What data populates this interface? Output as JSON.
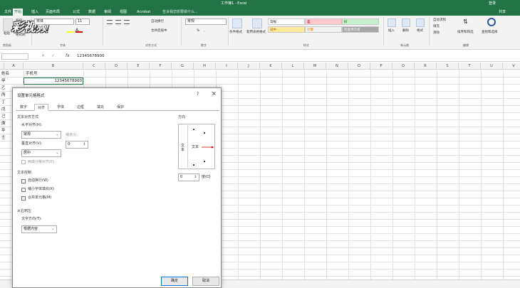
{
  "titlebar": {
    "title": "工作簿1 - Excel",
    "account": "登录",
    "share": "共享"
  },
  "tabs": [
    "文件",
    "开始",
    "插入",
    "页面布局",
    "公式",
    "数据",
    "审阅",
    "视图",
    "Acrobat"
  ],
  "active_tab": "开始",
  "tell_me": "告诉我您想要做什么...",
  "watermark": "彩视频",
  "ribbon": {
    "clipboard": {
      "paste_label": "粘贴",
      "cut": "剪切",
      "copy": "复制",
      "format_painter": "格式刷",
      "group": "剪贴板"
    },
    "font": {
      "name": "宋体",
      "size": "11",
      "bold": "B",
      "italic": "I",
      "underline": "U",
      "group": "字体"
    },
    "alignment": {
      "wrap": "自动换行",
      "merge": "合并后居中",
      "group": "对齐方式"
    },
    "number": {
      "format": "常规",
      "percent": "%",
      "comma": ",",
      "group": "数字"
    },
    "styles": {
      "cond_format": "条件格式",
      "table_format": "套用表格格式",
      "normal": "常规",
      "bad": "差",
      "good": "好",
      "neutral": "适中",
      "calc": "计算",
      "check": "检查单元格",
      "group": "样式"
    },
    "cells": {
      "insert": "插入",
      "delete": "删除",
      "format": "格式",
      "group": "单元格"
    },
    "editing": {
      "autosum": "自动求和",
      "fill": "填充",
      "clear": "清除",
      "sort": "排序和筛选",
      "find": "查找和选择",
      "group": "编辑"
    }
  },
  "formula_bar": {
    "name_box": "",
    "fx": "fx",
    "value": "12345678900"
  },
  "columns": [
    "A",
    "B",
    "C",
    "D",
    "E",
    "F",
    "G",
    "H",
    "I",
    "J",
    "K",
    "L",
    "M",
    "N",
    "O",
    "P",
    "Q",
    "R",
    "S",
    "T",
    "U",
    "V"
  ],
  "cells": {
    "a1": "姓名",
    "b1": "手机号",
    "b2": "12345678900",
    "a_col": [
      "甲",
      "乙",
      "丙",
      "丁",
      "戊",
      "己",
      "庚",
      "辛",
      "壬"
    ]
  },
  "dialog": {
    "title": "设置单元格格式",
    "help": "?",
    "close": "×",
    "tabs": [
      "数字",
      "对齐",
      "字体",
      "边框",
      "填充",
      "保护"
    ],
    "active_tab": "对齐",
    "text_align_section": "文本对齐方式",
    "horizontal_label": "水平对齐(H):",
    "horizontal_value": "常规",
    "indent_label": "缩进(I):",
    "indent_value": "0",
    "vertical_label": "垂直对齐(V):",
    "vertical_value": "居中",
    "justify_distributed": "两端分散对齐(E)",
    "text_control_section": "文本控制",
    "wrap_text": "自动换行(W)",
    "shrink_to_fit": "缩小字体填充(K)",
    "merge_cells": "合并单元格(M)",
    "rtl_section": "从右到左",
    "direction_label": "文字方向(T):",
    "direction_value": "根据内容",
    "orientation_section": "方向",
    "vertical_text": "文本",
    "orientation_text": "文本",
    "degrees_value": "0",
    "degrees_label": "度(D)",
    "ok": "确定",
    "cancel": "取消"
  }
}
